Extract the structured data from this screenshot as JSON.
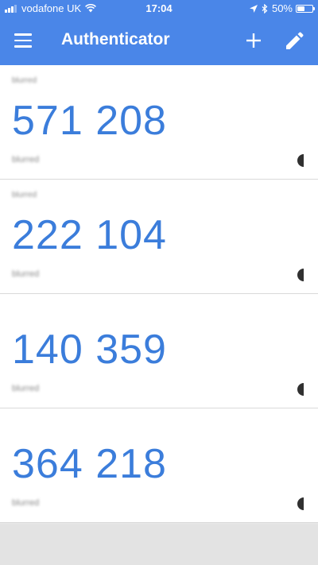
{
  "status_bar": {
    "carrier": "vodafone UK",
    "time": "17:04",
    "battery_percent": "50%",
    "battery_level": 0.5,
    "icons": [
      "signal-icon",
      "wifi-icon",
      "location-icon",
      "bluetooth-icon",
      "battery-icon"
    ]
  },
  "app_bar": {
    "title": "Authenticator",
    "icons": [
      "menu-icon",
      "plus-icon",
      "pencil-icon"
    ]
  },
  "entries": [
    {
      "issuer": "blurred",
      "code": "571 208",
      "account": "blurred",
      "timer_icon": "countdown-timer-icon"
    },
    {
      "issuer": "blurred",
      "code": "222 104",
      "account": "blurred",
      "timer_icon": "countdown-timer-icon"
    },
    {
      "issuer": "",
      "code": "140 359",
      "account": "blurred",
      "timer_icon": "countdown-timer-icon"
    },
    {
      "issuer": "",
      "code": "364 218",
      "account": "blurred",
      "timer_icon": "countdown-timer-icon"
    }
  ],
  "colors": {
    "primary": "#4a86e8",
    "code_text": "#3b7ddb",
    "background": "#ffffff",
    "footer": "#e3e3e3"
  }
}
